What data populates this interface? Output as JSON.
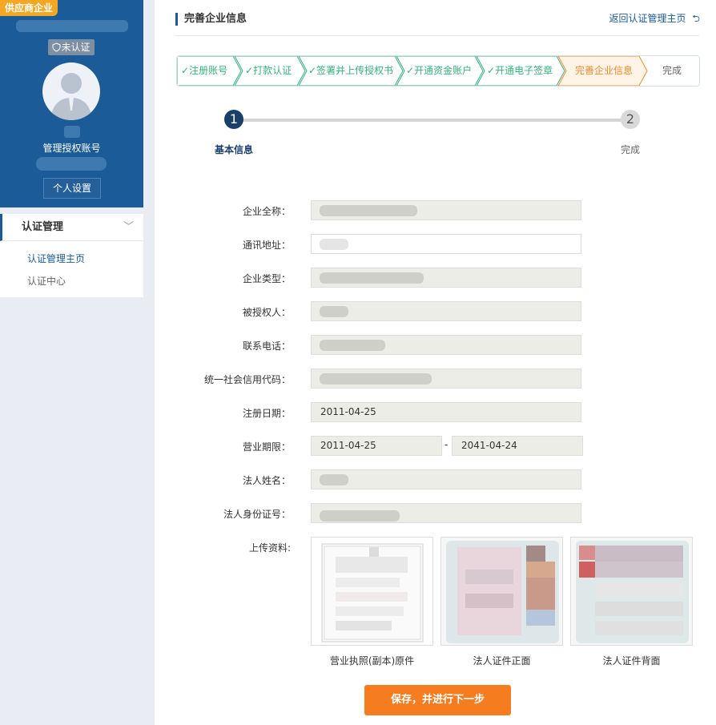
{
  "sidebar": {
    "tag": "供应商企业",
    "status": "未认证",
    "account_label": "管理授权账号",
    "settings_button": "个人设置",
    "menu": {
      "head": "认证管理",
      "items": [
        {
          "label": "认证管理主页",
          "active": true
        },
        {
          "label": "认证中心",
          "active": false
        }
      ]
    }
  },
  "header": {
    "title": "完善企业信息",
    "back_link": "返回认证管理主页"
  },
  "steps": [
    {
      "label": "注册账号",
      "state": "done"
    },
    {
      "label": "打款认证",
      "state": "done"
    },
    {
      "label": "签署并上传授权书",
      "state": "done"
    },
    {
      "label": "开通资金账户",
      "state": "done"
    },
    {
      "label": "开通电子签章",
      "state": "done"
    },
    {
      "label": "完善企业信息",
      "state": "current"
    },
    {
      "label": "完成",
      "state": "todo"
    }
  ],
  "tracker": {
    "nodes": [
      {
        "number": "1",
        "label": "基本信息",
        "active": true
      },
      {
        "number": "2",
        "label": "完成",
        "active": false
      }
    ]
  },
  "form": {
    "company_name": {
      "label": "企业全称：",
      "value": ""
    },
    "address": {
      "label": "通讯地址：",
      "value": ""
    },
    "company_type": {
      "label": "企业类型：",
      "value": ""
    },
    "authorized_person": {
      "label": "被授权人：",
      "value": ""
    },
    "phone": {
      "label": "联系电话：",
      "value": ""
    },
    "credit_code": {
      "label": "统一社会信用代码：",
      "value": ""
    },
    "reg_date": {
      "label": "注册日期：",
      "value": "2011-04-25"
    },
    "business_term": {
      "label": "营业期限：",
      "start": "2011-04-25",
      "end": "2041-04-24",
      "separator": "-"
    },
    "legal_name": {
      "label": "法人姓名：",
      "value": ""
    },
    "legal_id": {
      "label": "法人身份证号：",
      "value": ""
    },
    "upload_label": "上传资料:"
  },
  "uploads": [
    {
      "caption": "营业执照(副本)原件"
    },
    {
      "caption": "法人证件正面"
    },
    {
      "caption": "法人证件背面"
    }
  ],
  "actions": {
    "save_next": "保存，并进行下一步"
  },
  "colors": {
    "brand": "#1b5b97",
    "accent": "#f57c1f",
    "done": "#36b07e",
    "current": "#f08a2c"
  }
}
